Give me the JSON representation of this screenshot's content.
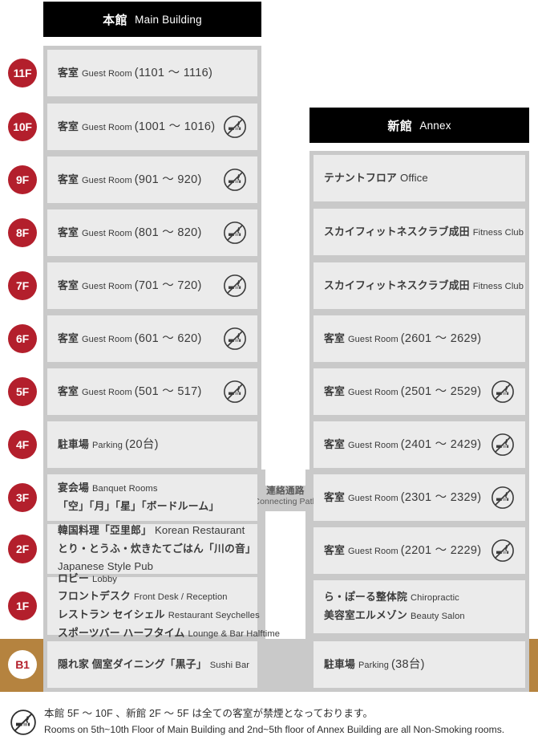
{
  "colors": {
    "badge_red": "#b31f2c",
    "ground_brown": "#b5833f",
    "header_black": "#000000",
    "cell_gray": "#ebebeb",
    "frame_gray": "#c9c9c9"
  },
  "buildings": {
    "main": {
      "name_ja": "本館",
      "name_en": "Main Building"
    },
    "annex": {
      "name_ja": "新館",
      "name_en": "Annex"
    }
  },
  "connecting_path": {
    "label_ja": "連絡通路",
    "label_en": "Connecting Path"
  },
  "icons": {
    "non_smoking": "no-smoking-icon"
  },
  "main_floors": [
    {
      "badge": "11F",
      "lines": [
        {
          "ja": "客室",
          "en": "Guest Room",
          "num": "(1101 〜 1116)"
        }
      ],
      "non_smoking": false
    },
    {
      "badge": "10F",
      "lines": [
        {
          "ja": "客室",
          "en": "Guest Room",
          "num": "(1001 〜 1016)"
        }
      ],
      "non_smoking": true
    },
    {
      "badge": "9F",
      "lines": [
        {
          "ja": "客室",
          "en": "Guest Room",
          "num": "(901 〜 920)"
        }
      ],
      "non_smoking": true
    },
    {
      "badge": "8F",
      "lines": [
        {
          "ja": "客室",
          "en": "Guest Room",
          "num": "(801 〜 820)"
        }
      ],
      "non_smoking": true
    },
    {
      "badge": "7F",
      "lines": [
        {
          "ja": "客室",
          "en": "Guest Room",
          "num": "(701 〜 720)"
        }
      ],
      "non_smoking": true
    },
    {
      "badge": "6F",
      "lines": [
        {
          "ja": "客室",
          "en": "Guest Room",
          "num": "(601 〜 620)"
        }
      ],
      "non_smoking": true
    },
    {
      "badge": "5F",
      "lines": [
        {
          "ja": "客室",
          "en": "Guest Room",
          "num": "(501 〜 517)"
        }
      ],
      "non_smoking": true
    },
    {
      "badge": "4F",
      "lines": [
        {
          "ja": "駐車場",
          "en": "Parking",
          "num": "(20台)"
        }
      ],
      "non_smoking": false
    },
    {
      "badge": "3F",
      "lines": [
        {
          "ja": "宴会場",
          "en": "Banquet Rooms"
        },
        {
          "ja": "「空」「月」「星」「ボードルーム」",
          "en": ""
        }
      ],
      "non_smoking": false
    },
    {
      "badge": "2F",
      "lines": [
        {
          "ja": "韓国料理「亞里郎」",
          "en": "Korean Restaurant",
          "en_big": true
        },
        {
          "ja": "とり・とうふ・炊きたてごはん「川の音」",
          "en": ""
        },
        {
          "ja": "",
          "en": "Japanese Style Pub",
          "en_big": true
        }
      ],
      "non_smoking": false
    },
    {
      "badge": "1F",
      "lines": [
        {
          "ja": "ロビー",
          "en": "Lobby"
        },
        {
          "ja": "フロントデスク",
          "en": "Front Desk / Reception"
        },
        {
          "ja": "レストラン セイシェル",
          "en": "Restaurant Seychelles"
        },
        {
          "ja": "スポーツバー ハーフタイム",
          "en": "Lounge & Bar Halftime"
        }
      ],
      "non_smoking": false
    },
    {
      "badge": "B1",
      "lines": [
        {
          "ja": "隠れ家 個室ダイニング「黒子」",
          "en": "Sushi Bar"
        }
      ],
      "non_smoking": false,
      "basement": true
    }
  ],
  "annex_floors": [
    {
      "badge": "9F",
      "lines": [
        {
          "ja": "テナントフロア",
          "en": "Office",
          "en_big": true
        }
      ],
      "non_smoking": false
    },
    {
      "badge": "8F",
      "lines": [
        {
          "ja": "スカイフィットネスクラブ成田",
          "en": "Fitness Club"
        }
      ],
      "non_smoking": false
    },
    {
      "badge": "7F",
      "lines": [
        {
          "ja": "スカイフィットネスクラブ成田",
          "en": "Fitness Club"
        }
      ],
      "non_smoking": false
    },
    {
      "badge": "6F",
      "lines": [
        {
          "ja": "客室",
          "en": "Guest Room",
          "num": "(2601 〜 2629)"
        }
      ],
      "non_smoking": false
    },
    {
      "badge": "5F",
      "lines": [
        {
          "ja": "客室",
          "en": "Guest Room",
          "num": "(2501 〜 2529)"
        }
      ],
      "non_smoking": true
    },
    {
      "badge": "4F",
      "lines": [
        {
          "ja": "客室",
          "en": "Guest Room",
          "num": "(2401 〜 2429)"
        }
      ],
      "non_smoking": true
    },
    {
      "badge": "3F",
      "lines": [
        {
          "ja": "客室",
          "en": "Guest Room",
          "num": "(2301 〜 2329)"
        }
      ],
      "non_smoking": true
    },
    {
      "badge": "2F",
      "lines": [
        {
          "ja": "客室",
          "en": "Guest Room",
          "num": "(2201 〜 2229)"
        }
      ],
      "non_smoking": true
    },
    {
      "badge": "1F",
      "lines": [
        {
          "ja": "ら・ぽーる整体院",
          "en": "Chiropractic"
        },
        {
          "ja": "美容室エルメゾン",
          "en": "Beauty Salon"
        }
      ],
      "non_smoking": false
    },
    {
      "badge": "B1",
      "lines": [
        {
          "ja": "駐車場",
          "en": "Parking",
          "num": "(38台)"
        }
      ],
      "non_smoking": false,
      "basement": true
    }
  ],
  "footer": {
    "line_ja": "本館 5F 〜 10F 、新館 2F 〜 5F は全ての客室が禁煙となっております。",
    "line_en": "Rooms on 5th~10th Floor of Main Building and 2nd~5th floor of Annex Building are all Non-Smoking rooms."
  }
}
